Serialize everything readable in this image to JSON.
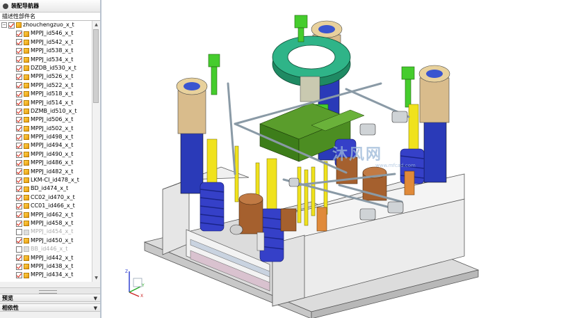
{
  "navigator": {
    "title": "装配导航器",
    "column_header": "描述性部件名",
    "root": {
      "label": "zhouchengzuo_x_t",
      "checked": true
    },
    "items": [
      {
        "label": "MPPJ_id546_x_t",
        "checked": true
      },
      {
        "label": "MPPJ_id542_x_t",
        "checked": true
      },
      {
        "label": "MPPJ_id538_x_t",
        "checked": true
      },
      {
        "label": "MPPJ_id534_x_t",
        "checked": true
      },
      {
        "label": "DZDB_id530_x_t",
        "checked": true
      },
      {
        "label": "MPPJ_id526_x_t",
        "checked": true
      },
      {
        "label": "MPPJ_id522_x_t",
        "checked": true
      },
      {
        "label": "MPPJ_id518_x_t",
        "checked": true
      },
      {
        "label": "MPPJ_id514_x_t",
        "checked": true
      },
      {
        "label": "DZMB_id510_x_t",
        "checked": true
      },
      {
        "label": "MPPJ_id506_x_t",
        "checked": true
      },
      {
        "label": "MPPJ_id502_x_t",
        "checked": true
      },
      {
        "label": "MPPJ_id498_x_t",
        "checked": true
      },
      {
        "label": "MPPJ_id494_x_t",
        "checked": true
      },
      {
        "label": "MPPJ_id490_x_t",
        "checked": true
      },
      {
        "label": "MPPJ_id486_x_t",
        "checked": true
      },
      {
        "label": "MPPJ_id482_x_t",
        "checked": true
      },
      {
        "label": "LKM-CI_id478_x_t",
        "checked": true
      },
      {
        "label": "BD_id474_x_t",
        "checked": true
      },
      {
        "label": "CC02_id470_x_t",
        "checked": true
      },
      {
        "label": "CC01_id466_x_t",
        "checked": true
      },
      {
        "label": "MPPJ_id462_x_t",
        "checked": true
      },
      {
        "label": "MPPJ_id458_x_t",
        "checked": true
      },
      {
        "label": "MPPJ_id454_x_t",
        "checked": false
      },
      {
        "label": "MPPJ_id450_x_t",
        "checked": true
      },
      {
        "label": "BB_id446_x_t",
        "checked": false
      },
      {
        "label": "MPPJ_id442_x_t",
        "checked": true
      },
      {
        "label": "MPPJ_id438_x_t",
        "checked": true
      },
      {
        "label": "MPPJ_id434_x_t",
        "checked": true
      }
    ]
  },
  "panels": {
    "preview": "预览",
    "dependencies": "相依性"
  },
  "watermark": {
    "main": "沐风网",
    "sub": "www.mfcad.com"
  },
  "triad": {
    "x": "X",
    "y": "Y",
    "z": "Z"
  },
  "colors": {
    "bolt_green": "#45cc2d",
    "spring_blue": "#3540c8",
    "pin_yellow": "#f0e21d",
    "bushing_tan": "#d9bc8c",
    "slider_green": "#3d7d1a",
    "block_orange": "#d97b3c",
    "ring_teal": "#2aa07c",
    "base_grey": "#e6e6e6"
  }
}
